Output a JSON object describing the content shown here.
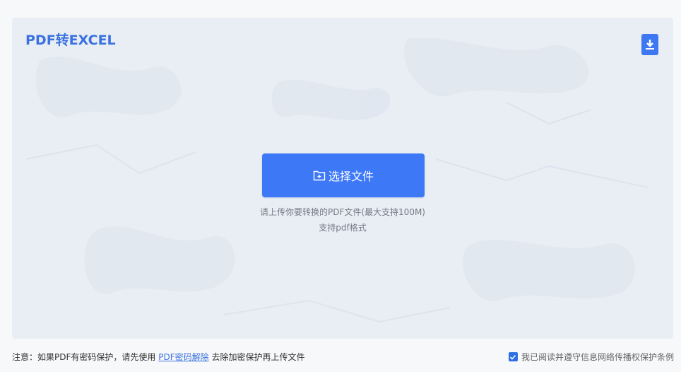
{
  "header": {
    "title": "PDF转EXCEL",
    "download_icon": "download-icon"
  },
  "upload": {
    "button_label": "选择文件",
    "button_icon": "folder-add-icon",
    "hint_line1": "请上传你要转换的PDF文件(最大支持100M)",
    "hint_line2": "支持pdf格式"
  },
  "footer": {
    "note_prefix": "注意：如果PDF有密码保护，请先使用",
    "note_link": "PDF密码解除",
    "note_suffix": "去除加密保护再上传文件",
    "agreement_checked": true,
    "agreement_label": "我已阅读并遵守信息网络传播权保护条例"
  },
  "colors": {
    "accent": "#3d78f6",
    "panel_bg": "#e9eef5",
    "hint_text": "#757b86"
  }
}
